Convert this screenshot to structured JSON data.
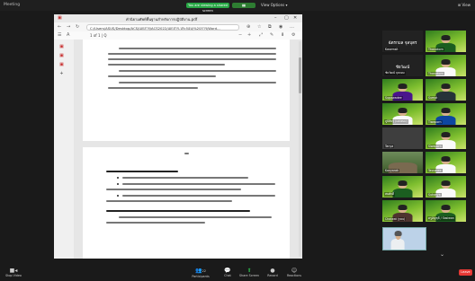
{
  "app": {
    "window_title": "Meeting",
    "sharing_banner": "You are viewing a shared screen",
    "view_options": "View Options ▾",
    "view_right": "⊞ View"
  },
  "browser": {
    "tab_title": "คำนิยามศัพท์พื้นฐานสำหรับการปฏิบัติงาน.pdf",
    "address": "C:/Users/ASUS/Desktop/ACS/เอกสาร/ACS2022/เอกสาร-ประกอบ/%20การ/Word..."
  },
  "pdf": {
    "page_indicator": "1 of 1 | Q"
  },
  "participants": [
    {
      "name": "Kasemsit",
      "label": "ฉัตรกมล จุลบุตร"
    },
    {
      "name": "Thanakorn"
    },
    {
      "name": "ชัยวัฒน์ จุลจอม",
      "label": "ชัยวัฒน์"
    },
    {
      "name": "Thanakorn"
    },
    {
      "name": "Supawadee"
    },
    {
      "name": "Sumat"
    },
    {
      "name": "ภูมิศิษฐ์ (แสงทอง)"
    },
    {
      "name": "Tiwaporn"
    },
    {
      "name": "Tanya"
    },
    {
      "name": "Siwaporn"
    },
    {
      "name": "Kanyarak"
    },
    {
      "name": "Tassanee"
    },
    {
      "name": "สมศักดิ์"
    },
    {
      "name": "Sukanya"
    },
    {
      "name": "Chaiwat (you)"
    },
    {
      "name": "ครูอัญชุลี / Sasiwan"
    }
  ],
  "toolbar": {
    "video": "Stop Video",
    "participants": "Participants",
    "participants_count": "22",
    "chat": "Chat",
    "share": "Share Screen",
    "record": "Record",
    "reactions": "Reactions",
    "leave": "Leave"
  },
  "colors": {
    "accent_green": "#28a745",
    "leave_red": "#e53935"
  }
}
